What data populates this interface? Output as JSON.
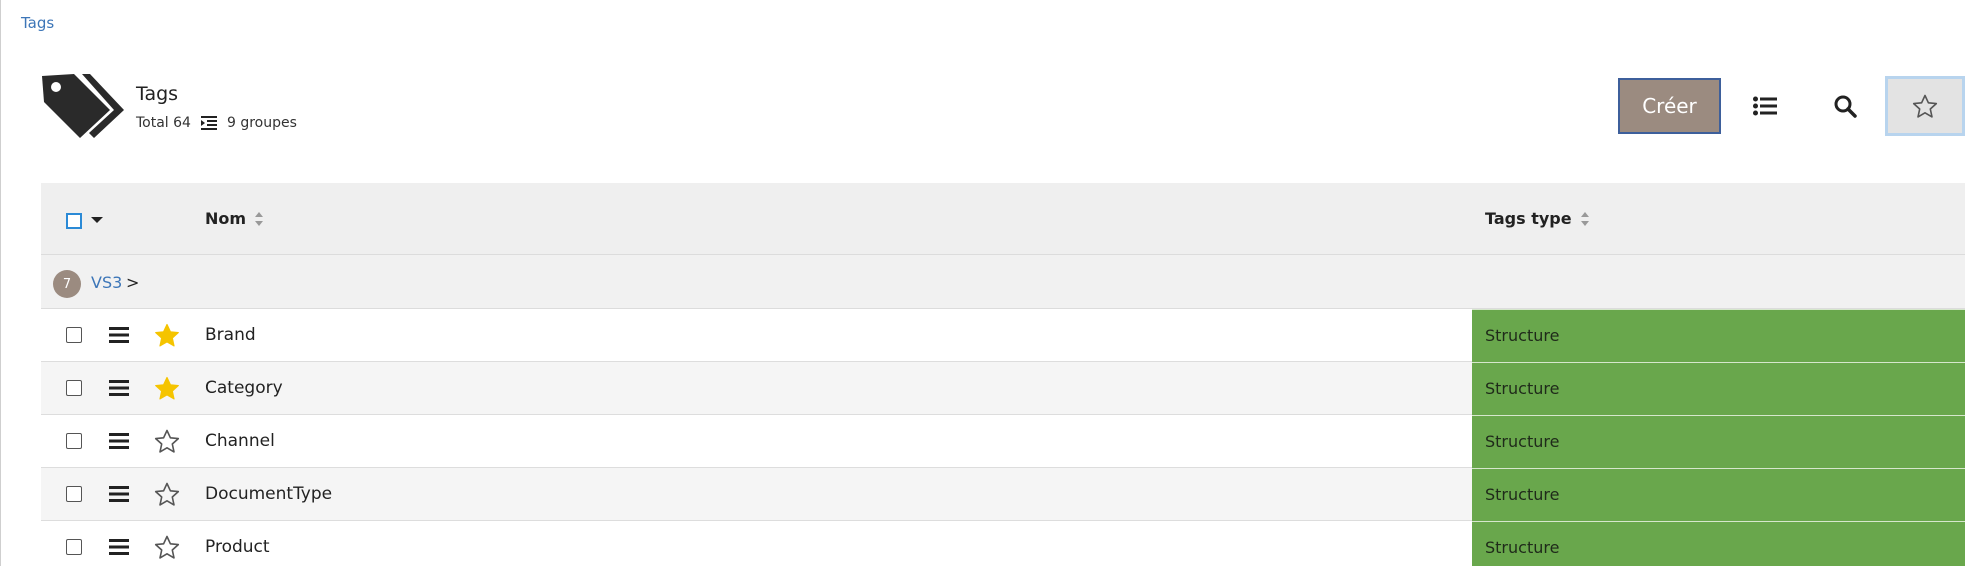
{
  "breadcrumb": "Tags",
  "header": {
    "title": "Tags",
    "total": "Total 64",
    "groups": "9 groupes"
  },
  "toolbar": {
    "create_label": "Créer"
  },
  "table": {
    "columns": [
      "Nom",
      "Tags type"
    ],
    "group": {
      "count": "7",
      "name": "VS3",
      "arrow": ">"
    },
    "rows": [
      {
        "name": "Brand",
        "type": "Structure",
        "favorite": true
      },
      {
        "name": "Category",
        "type": "Structure",
        "favorite": true
      },
      {
        "name": "Channel",
        "type": "Structure",
        "favorite": false
      },
      {
        "name": "DocumentType",
        "type": "Structure",
        "favorite": false
      },
      {
        "name": "Product",
        "type": "Structure",
        "favorite": false
      }
    ]
  },
  "colors": {
    "accent": "#9b8b80",
    "link": "#3d76b8",
    "type_bg": "#69a74c",
    "star_fill": "#f5c400"
  }
}
